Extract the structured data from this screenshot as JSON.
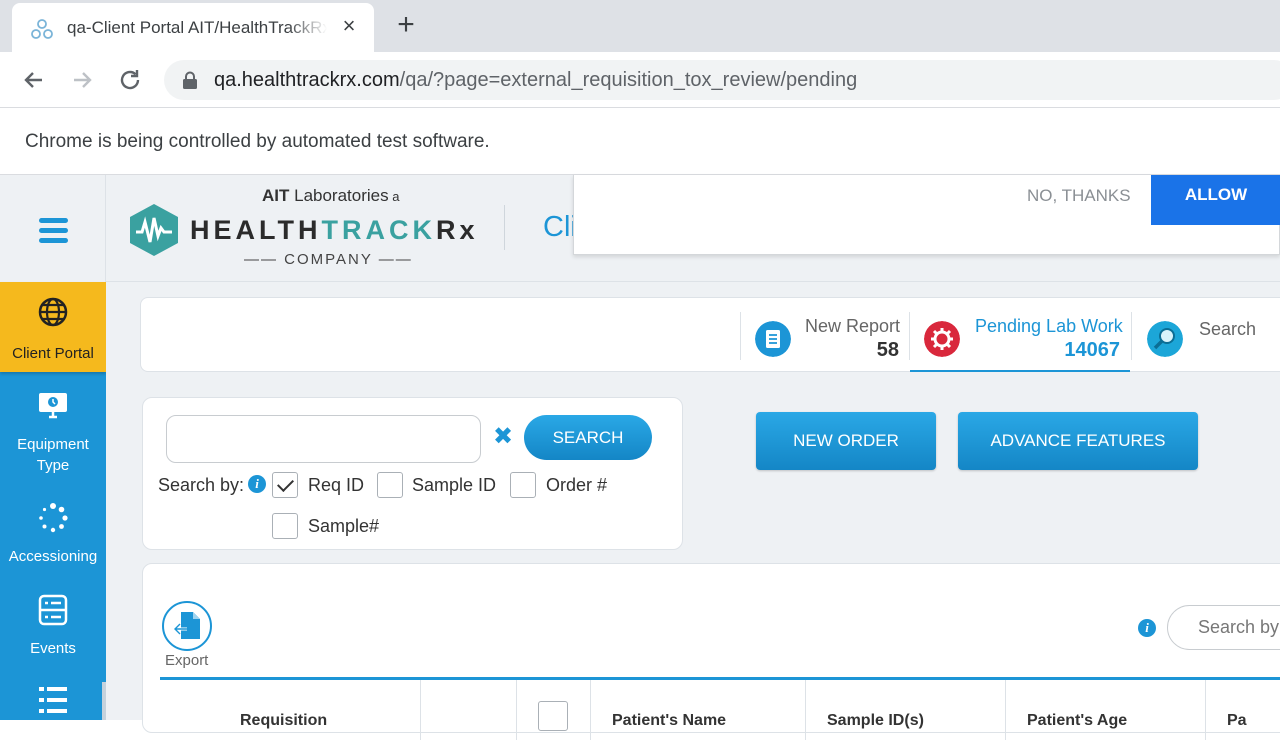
{
  "browser": {
    "tab_title": "qa-Client Portal AIT/HealthTrackRx",
    "url_host": "qa.healthtrackrx.com",
    "url_path": "/qa/?page=external_requisition_tox_review/pending",
    "infobar_text": "Chrome is being controlled by automated test software."
  },
  "header": {
    "logo_top_bold": "AIT",
    "logo_top_rest": " Laboratories",
    "logo_top_small": " a",
    "logo_main_a": "HEALTH",
    "logo_main_b": "TRACK",
    "logo_main_c": "Rx",
    "logo_sub": "—— COMPANY ——",
    "title": "Cli"
  },
  "notification": {
    "no_label": "NO, THANKS",
    "allow_label": "ALLOW"
  },
  "sidebar": {
    "items": [
      {
        "label": "Client Portal",
        "icon": "globe-icon"
      },
      {
        "label": "Equipment Type",
        "icon": "monitor-icon"
      },
      {
        "label": "Accessioning",
        "icon": "loading-icon"
      },
      {
        "label": "Events",
        "icon": "server-icon"
      },
      {
        "label": "",
        "icon": "list-icon"
      }
    ]
  },
  "stats": [
    {
      "label": "New Report",
      "value": "58",
      "icon": "document-icon",
      "color": "#1c95d6"
    },
    {
      "label": "Pending Lab Work",
      "value": "14067",
      "icon": "gear-icon",
      "color": "#d9283c"
    },
    {
      "label": "Search",
      "value": "",
      "icon": "search-icon",
      "color": "#1ca6d8"
    }
  ],
  "search": {
    "input_value": "",
    "button_label": "SEARCH",
    "searchby_label": "Search by:",
    "options": [
      {
        "label": "Req ID",
        "checked": true
      },
      {
        "label": "Sample ID",
        "checked": false
      },
      {
        "label": "Order #",
        "checked": false
      },
      {
        "label": "Sample#",
        "checked": false
      }
    ]
  },
  "actions": {
    "new_order": "NEW ORDER",
    "advance_features": "ADVANCE FEATURES"
  },
  "table": {
    "export_label": "Export",
    "search_placeholder": "Search by",
    "columns": [
      "Requisition",
      "",
      "",
      "Patient's Name",
      "Sample ID(s)",
      "Patient's Age",
      "Pa"
    ]
  },
  "colors": {
    "accent": "#1c95d6",
    "sidebar_active": "#f5b91d",
    "allow_button": "#1a73e8"
  }
}
